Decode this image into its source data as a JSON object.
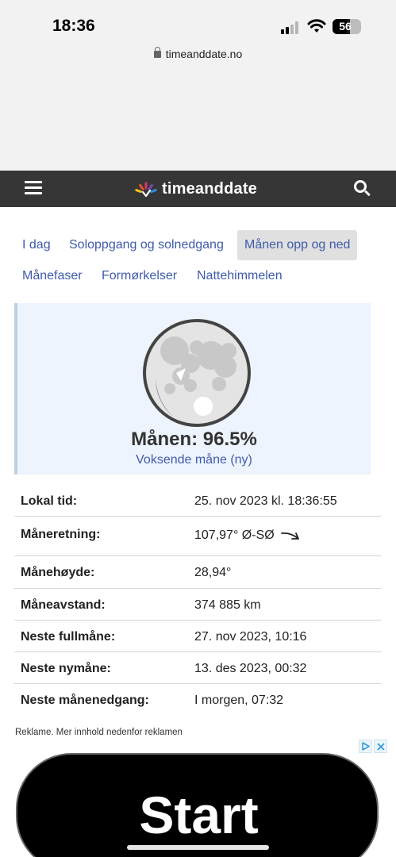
{
  "status_bar": {
    "time": "18:36",
    "battery": "56",
    "battery_level": 0.56,
    "url": "timeanddate.no"
  },
  "site": {
    "logo_text": "timeanddate",
    "logo_colors": [
      "#f2c21b",
      "#e94f2e",
      "#d9366b",
      "#7b4aa8",
      "#2f8fd8",
      "#5bbd4d"
    ]
  },
  "nav": {
    "tabs": [
      {
        "label": "I dag",
        "active": false
      },
      {
        "label": "Soloppgang og solnedgang",
        "active": false
      },
      {
        "label": "Månen opp og ned",
        "active": true
      },
      {
        "label": "Månefaser",
        "active": false
      },
      {
        "label": "Formørkelser",
        "active": false
      },
      {
        "label": "Nattehimmelen",
        "active": false
      }
    ]
  },
  "moon": {
    "title": "Månen: 96.5%",
    "illumination_percent": 96.5,
    "phase": "Voksende måne (ny)"
  },
  "info_rows": [
    {
      "label": "Lokal tid:",
      "value": "25. nov 2023 kl. 18:36:55"
    },
    {
      "label": "Måneretning:",
      "value": "107,97° Ø-SØ",
      "icon": "direction-arrow-icon"
    },
    {
      "label": "Månehøyde:",
      "value": "28,94°"
    },
    {
      "label": "Måneavstand:",
      "value": "374 885 km"
    },
    {
      "label": "Neste fullmåne:",
      "value": "27. nov 2023, 10:16"
    },
    {
      "label": "Neste nymåne:",
      "value": "13. des 2023, 00:32"
    },
    {
      "label": "Neste månenedgang:",
      "value": "I morgen, 07:32"
    }
  ],
  "ad": {
    "note": "Reklame. Mer innhold nedenfor reklamen",
    "banner_text": "Start"
  }
}
